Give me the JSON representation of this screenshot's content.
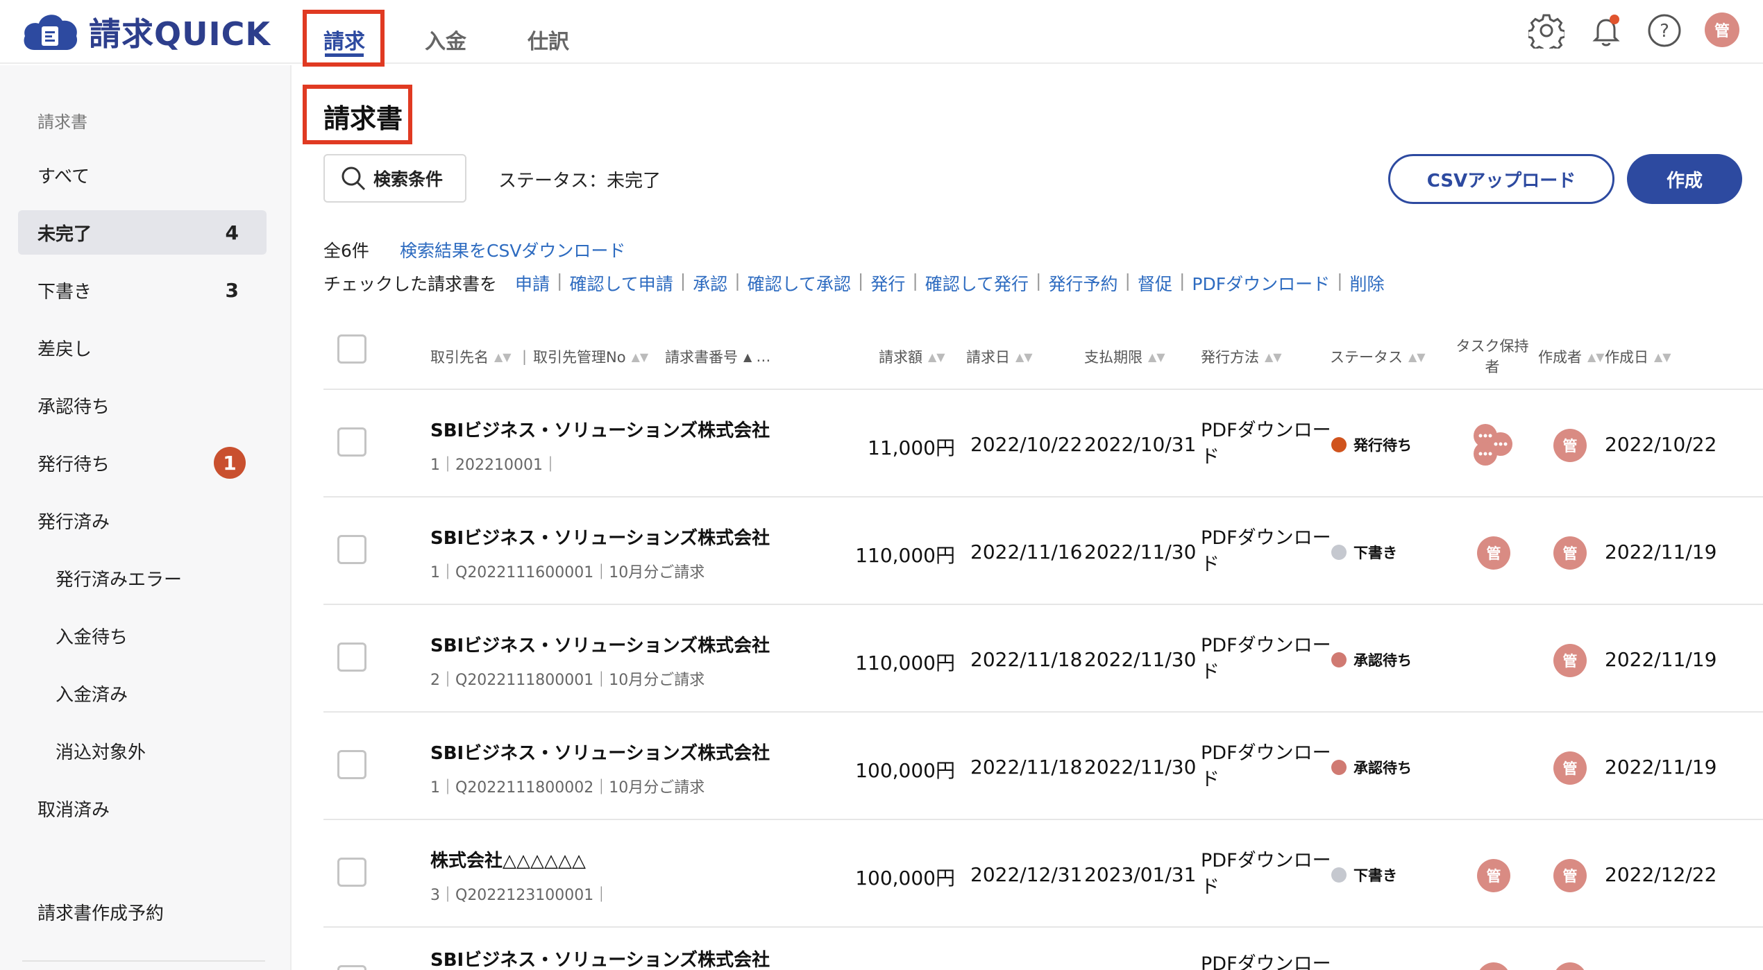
{
  "app": {
    "logo_text": "請求QUICK"
  },
  "nav": {
    "tabs": [
      {
        "label": "請求"
      },
      {
        "label": "入金"
      },
      {
        "label": "仕訳"
      }
    ]
  },
  "header": {
    "user_avatar": "管",
    "icons": [
      "gear-icon",
      "bell-icon",
      "help-icon"
    ],
    "notification_color": "#e0542e"
  },
  "sidebar": {
    "section_header": "請求書",
    "items": [
      {
        "label": "すべて"
      },
      {
        "label": "未完了",
        "count": "4"
      },
      {
        "label": "下書き",
        "count": "3"
      },
      {
        "label": "差戻し"
      },
      {
        "label": "承認待ち"
      },
      {
        "label": "発行待ち",
        "badge": "1"
      },
      {
        "label": "発行済み"
      },
      {
        "label": "発行済みエラー"
      },
      {
        "label": "入金待ち"
      },
      {
        "label": "入金済み"
      },
      {
        "label": "消込対象外"
      },
      {
        "label": "取消済み"
      }
    ],
    "footer_item": "請求書作成予約"
  },
  "main": {
    "title": "請求書",
    "search_button": "検索条件",
    "status_filter": "ステータス：未完了",
    "csv_upload": "CSVアップロード",
    "create": "作成",
    "total": "全6件",
    "csv_download": "検索結果をCSVダウンロード",
    "bulk_prefix": "チェックした請求書を",
    "bulk_actions": [
      "申請",
      "確認して申請",
      "承認",
      "確認して承認",
      "発行",
      "確認して発行",
      "発行予約",
      "督促",
      "PDFダウンロード",
      "削除"
    ]
  },
  "table": {
    "columns": {
      "client": "取引先名",
      "client_no": "取引先管理No",
      "invoice_no": "請求書番号",
      "more": "…",
      "amount": "請求額",
      "invoice_date": "請求日",
      "due_date": "支払期限",
      "method": "発行方法",
      "status": "ステータス",
      "task_holder": "タスク保持者",
      "creator": "作成者",
      "created": "作成日"
    },
    "rows": [
      {
        "client": "SBIビジネス・ソリューションズ株式会社",
        "sub": "1｜202210001｜",
        "amount": "11,000円",
        "invoice_date": "2022/10/22",
        "due_date": "2022/10/31",
        "method": "PDFダウンロード",
        "status": "発行待ち",
        "status_color": "#d0541e",
        "task": "",
        "creator": "管",
        "created": "2022/10/22"
      },
      {
        "client": "SBIビジネス・ソリューションズ株式会社",
        "sub": "1｜Q2022111600001｜10月分ご請求",
        "amount": "110,000円",
        "invoice_date": "2022/11/16",
        "due_date": "2022/11/30",
        "method": "PDFダウンロード",
        "status": "下書き",
        "status_color": "#c5c8cf",
        "task": "管",
        "creator": "管",
        "created": "2022/11/19"
      },
      {
        "client": "SBIビジネス・ソリューションズ株式会社",
        "sub": "2｜Q2022111800001｜10月分ご請求",
        "amount": "110,000円",
        "invoice_date": "2022/11/18",
        "due_date": "2022/11/30",
        "method": "PDFダウンロード",
        "status": "承認待ち",
        "status_color": "#d07a72",
        "task": "",
        "creator": "管",
        "created": "2022/11/19"
      },
      {
        "client": "SBIビジネス・ソリューションズ株式会社",
        "sub": "1｜Q2022111800002｜10月分ご請求",
        "amount": "100,000円",
        "invoice_date": "2022/11/18",
        "due_date": "2022/11/30",
        "method": "PDFダウンロード",
        "status": "承認待ち",
        "status_color": "#d07a72",
        "task": "",
        "creator": "管",
        "created": "2022/11/19"
      },
      {
        "client": "株式会社△△△△△△",
        "sub": "3｜Q2022123100001｜",
        "amount": "100,000円",
        "invoice_date": "2022/12/31",
        "due_date": "2023/01/31",
        "method": "PDFダウンロード",
        "status": "下書き",
        "status_color": "#c5c8cf",
        "task": "管",
        "creator": "管",
        "created": "2022/12/22"
      },
      {
        "client": "SBIビジネス・ソリューションズ株式会社",
        "sub": "",
        "amount": "",
        "invoice_date": "",
        "due_date": "",
        "method": "PDFダウンロー",
        "status": "",
        "status_color": "",
        "task": "",
        "creator": "",
        "created": ""
      }
    ]
  }
}
